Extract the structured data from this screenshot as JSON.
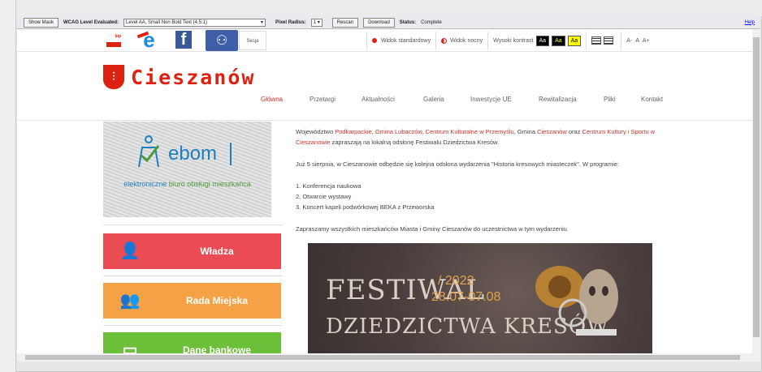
{
  "toolbar": {
    "show_mask": "Show Mask",
    "wcag_label": "WCAG Level Evaluated:",
    "wcag_value": "Level AA, Small Non Bold Text (4.5:1)",
    "pixel_label": "Pixel Radius:",
    "pixel_value": "1",
    "rescan": "Rescan",
    "download": "Download",
    "status_label": "Status:",
    "status_value": "Complete",
    "help": "Help"
  },
  "topbar": {
    "bip": "bip",
    "sesja": "Sesja",
    "standard_view": "Widok standardowy",
    "night_view": "Widok nocny",
    "high_contrast": "Wysoki kontrast",
    "aa": [
      "Aa",
      "Aa",
      "Aa"
    ],
    "font_sizes": [
      "A-",
      "A",
      "A+"
    ]
  },
  "logo": {
    "text": "Cieszanów"
  },
  "nav": [
    "Główna",
    "Przetargi",
    "Aktualności",
    "Galeria",
    "Inwestycje UE",
    "Rewitalizacja",
    "Pliki",
    "Kontakt"
  ],
  "sidebar": {
    "ebom_title": "ebom",
    "ebom_sub_prefix": "elektroniczne ",
    "ebom_sub_suffix": "biuro obsługi mieszkańca",
    "tiles": [
      "Władza",
      "Rada Miejska",
      "Dane bankowe"
    ]
  },
  "article": {
    "p1_a": "Województwo ",
    "p1_link1": "Podkarpackie, Gmina Lubaczów, Centrum Kulturalne w Przemyślu",
    "p1_b": ", Gmina ",
    "p1_link2": "Cieszanów",
    "p1_c": " oraz ",
    "p1_link3": "Centrum Kultury i Sportu w Cieszanowie",
    "p1_d": " zapraszają na lokalną odsłonę Festiwalu Dziedzictwa Kresów.",
    "p2": "Już 5 sierpnia, w Cieszanowie odbędzie się kolejna odsłona wydarzenia \"Historia kresowych miasteczek\". W programie:",
    "items": [
      "1. Konferencja naukowa",
      "2. Otwarcie wystawy",
      "3. Koncert kapeli podwórkowej BEKA z Przeworska"
    ],
    "p3": "Zapraszamy wszystkich mieszkańców Miasta i Gminy Cieszanów do uczestnictwa w tym wydarzeniu."
  },
  "festival": {
    "line1": "FESTIWAL",
    "year": "/ 2022",
    "dates": "28.07-07.08",
    "line2": "DZIEDZICTWA KRESÓW"
  },
  "colors": {
    "accent": "#d3312b",
    "tile1": "#e94c54",
    "tile2": "#f4a245",
    "tile3": "#6cbf38"
  }
}
